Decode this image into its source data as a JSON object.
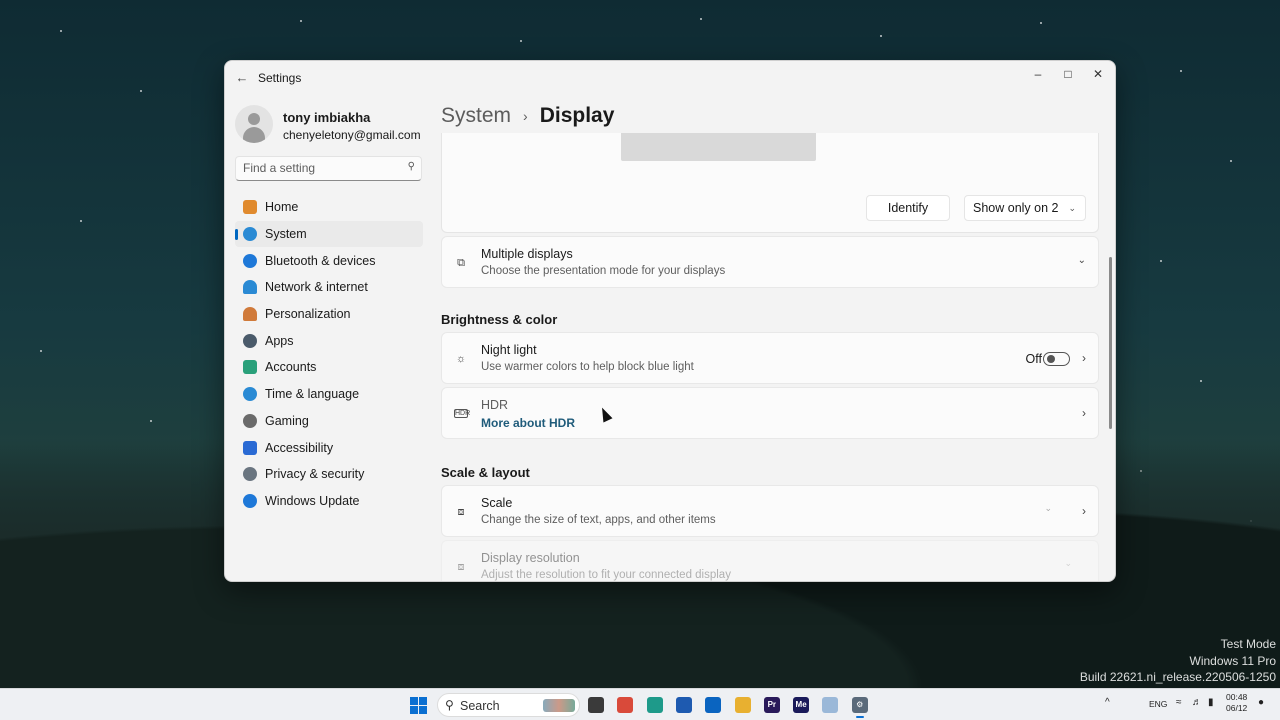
{
  "window": {
    "app_title": "Settings",
    "controls": {
      "minimize": "–",
      "maximize": "□",
      "close": "✕"
    }
  },
  "profile": {
    "name": "tony imbiakha",
    "email": "chenyeletony@gmail.com"
  },
  "search": {
    "placeholder": "Find a setting"
  },
  "nav": {
    "items": [
      {
        "label": "Home",
        "icon": "home-icon",
        "color": "#e08a2e",
        "active": false
      },
      {
        "label": "System",
        "icon": "system-icon",
        "color": "#2a8ad4",
        "active": true
      },
      {
        "label": "Bluetooth & devices",
        "icon": "bluetooth-icon",
        "color": "#1e78d8",
        "active": false
      },
      {
        "label": "Network & internet",
        "icon": "wifi-icon",
        "color": "#2a8ad4",
        "active": false
      },
      {
        "label": "Personalization",
        "icon": "brush-icon",
        "color": "#d07a3a",
        "active": false
      },
      {
        "label": "Apps",
        "icon": "apps-icon",
        "color": "#4a5a6a",
        "active": false
      },
      {
        "label": "Accounts",
        "icon": "accounts-icon",
        "color": "#2aa07a",
        "active": false
      },
      {
        "label": "Time & language",
        "icon": "globe-icon",
        "color": "#2a8ad4",
        "active": false
      },
      {
        "label": "Gaming",
        "icon": "gaming-icon",
        "color": "#6a6a6a",
        "active": false
      },
      {
        "label": "Accessibility",
        "icon": "accessibility-icon",
        "color": "#2a6ad4",
        "active": false
      },
      {
        "label": "Privacy & security",
        "icon": "shield-icon",
        "color": "#6a7580",
        "active": false
      },
      {
        "label": "Windows Update",
        "icon": "update-icon",
        "color": "#1e78d8",
        "active": false
      }
    ]
  },
  "breadcrumb": {
    "parent": "System",
    "separator": "›",
    "current": "Display"
  },
  "preview": {
    "identify_label": "Identify",
    "mode_select_value": "Show only on 2"
  },
  "multiple_displays": {
    "title": "Multiple displays",
    "subtitle": "Choose the presentation mode for your displays"
  },
  "brightness_section": {
    "title": "Brightness & color"
  },
  "night_light": {
    "title": "Night light",
    "subtitle": "Use warmer colors to help block blue light",
    "state_label": "Off",
    "enabled": false
  },
  "hdr": {
    "title": "HDR",
    "link": "More about HDR"
  },
  "scale_section": {
    "title": "Scale & layout"
  },
  "scale": {
    "title": "Scale",
    "subtitle": "Change the size of text, apps, and other items"
  },
  "resolution": {
    "title": "Display resolution",
    "subtitle": "Adjust the resolution to fit your connected display"
  },
  "watermark": {
    "line1": "Test Mode",
    "line2": "Windows 11 Pro",
    "line3": "Build 22621.ni_release.220506-1250"
  },
  "taskbar": {
    "search_label": "Search",
    "apps": [
      {
        "name": "file-manager-icon",
        "color": "#3a3a3a",
        "glyph": ""
      },
      {
        "name": "chrome-icon",
        "color": "#d94a3a",
        "glyph": ""
      },
      {
        "name": "edge-icon",
        "color": "#1e9a8a",
        "glyph": ""
      },
      {
        "name": "store-icon",
        "color": "#1e5ab0",
        "glyph": ""
      },
      {
        "name": "outlook-icon",
        "color": "#0a64c0",
        "glyph": ""
      },
      {
        "name": "explorer-icon",
        "color": "#e8b030",
        "glyph": ""
      },
      {
        "name": "premiere-icon",
        "color": "#2a1a5a",
        "glyph": "Pr"
      },
      {
        "name": "media-encoder-icon",
        "color": "#1a1a5a",
        "glyph": "Me"
      },
      {
        "name": "remote-desktop-icon",
        "color": "#9ab8d8",
        "glyph": ""
      },
      {
        "name": "settings-icon",
        "color": "#5a6a7a",
        "glyph": "⚙"
      }
    ],
    "tray": {
      "language": "ENG"
    },
    "clock": {
      "time": "00:48",
      "date": "06/12"
    }
  }
}
